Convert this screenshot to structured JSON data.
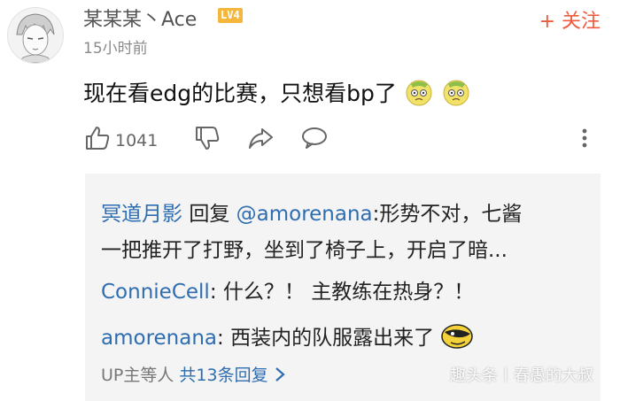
{
  "user": {
    "name": "某某某丶Ace",
    "level": "LV4",
    "time": "15小时前"
  },
  "follow_label": "+ 关注",
  "comment": {
    "text": "现在看edg的比赛，只想看bp了"
  },
  "actions": {
    "like_count": "1041"
  },
  "replies": [
    {
      "author": "冥道月影",
      "reply_word": "回复",
      "mention": "@amorenana",
      "text_line1": ":形势不对，七酱",
      "text_line2": "一把推开了打野，坐到了椅子上，开启了暗..."
    },
    {
      "author": "ConnieCell",
      "text": ": 什么？！ 主教练在热身？！"
    },
    {
      "author": "amorenana",
      "text": ": 西装内的队服露出来了"
    }
  ],
  "more": {
    "prefix": "UP主等人",
    "count": "共13条回复"
  },
  "watermark": "趣头条丨春愚的大叔",
  "colors": {
    "accent": "#ef5a3c",
    "link": "#2e6db0",
    "level_badge": "#f5b73b",
    "reply_bg": "#f4f4f4"
  }
}
